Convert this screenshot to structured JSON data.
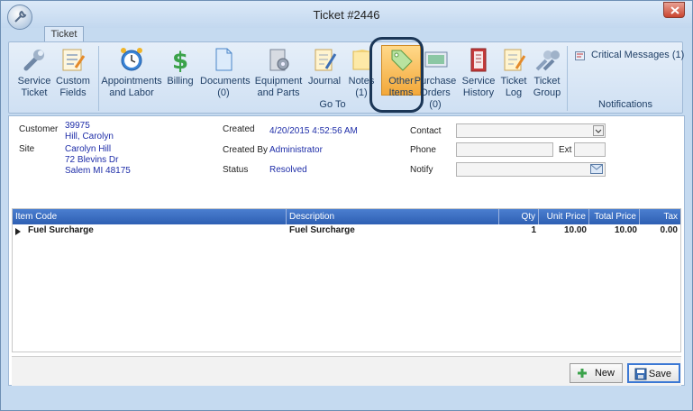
{
  "window": {
    "title": "Ticket #2446"
  },
  "tabs": [
    {
      "label": "Ticket"
    }
  ],
  "ribbon": {
    "goto_items": [
      {
        "line1": "Service",
        "line2": "Ticket",
        "icon": "wrench-icon"
      },
      {
        "line1": "Custom",
        "line2": "Fields",
        "icon": "edit-form-icon"
      },
      {
        "line1": "Appointments",
        "line2": "and Labor",
        "icon": "alarm-clock-icon"
      },
      {
        "line1": "Billing",
        "line2": "",
        "icon": "dollar-icon"
      },
      {
        "line1": "Documents",
        "line2": "(0)",
        "icon": "document-icon"
      },
      {
        "line1": "Equipment",
        "line2": "and Parts",
        "icon": "equipment-icon"
      },
      {
        "line1": "Journal",
        "line2": "",
        "icon": "journal-icon"
      },
      {
        "line1": "Notes",
        "line2": "(1)",
        "icon": "notes-icon"
      },
      {
        "line1": "Other",
        "line2": "Items",
        "icon": "tag-icon"
      },
      {
        "line1": "Purchase",
        "line2": "Orders (0)",
        "icon": "purchase-orders-icon"
      },
      {
        "line1": "Service",
        "line2": "History",
        "icon": "history-book-icon"
      },
      {
        "line1": "Ticket",
        "line2": "Log",
        "icon": "ticket-log-icon"
      },
      {
        "line1": "Ticket",
        "line2": "Group",
        "icon": "ticket-group-icon"
      }
    ],
    "goto_label": "Go To",
    "critical_messages": "Critical Messages (1)",
    "notifications_label": "Notifications"
  },
  "details": {
    "customer_label": "Customer",
    "customer_id": "39975",
    "customer_name": "Hill, Carolyn",
    "site_label": "Site",
    "site_line1": "Carolyn Hill",
    "site_line2": "72 Blevins Dr",
    "site_line3": "Salem MI 48175",
    "created_label": "Created",
    "created_value": "4/20/2015 4:52:56 AM",
    "created_by_label": "Created By",
    "created_by_value": "Administrator",
    "status_label": "Status",
    "status_value": "Resolved",
    "contact_label": "Contact",
    "phone_label": "Phone",
    "ext_label": "Ext",
    "notify_label": "Notify"
  },
  "grid": {
    "columns": [
      "Item Code",
      "Description",
      "Qty",
      "Unit Price",
      "Total Price",
      "Tax"
    ],
    "rows": [
      {
        "item_code": "Fuel Surcharge",
        "description": "Fuel Surcharge",
        "qty": "1",
        "unit_price": "10.00",
        "total_price": "10.00",
        "tax": "0.00"
      }
    ]
  },
  "buttons": {
    "new": "New",
    "save": "Save"
  },
  "colors": {
    "accent": "#2e5fb3",
    "highlight_ring": "#1b3656",
    "selected_button": "#f3a83a",
    "link_text": "#1e2da8"
  }
}
